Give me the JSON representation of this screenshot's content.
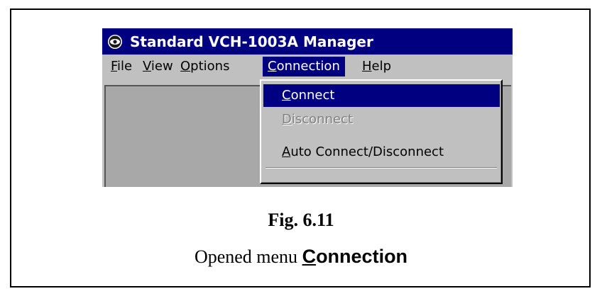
{
  "window": {
    "title": "Standard VCH-1003A Manager",
    "icon": "app-eye-icon"
  },
  "menubar": {
    "items": [
      {
        "label": "File",
        "mnemonic": "F",
        "rest": "ile"
      },
      {
        "label": "View",
        "mnemonic": "V",
        "rest": "iew"
      },
      {
        "label": "Options",
        "mnemonic": "O",
        "rest": "ptions"
      },
      {
        "label": "Connection",
        "mnemonic": "C",
        "rest": "onnection",
        "active": true
      },
      {
        "label": "Help",
        "mnemonic": "H",
        "rest": "elp"
      }
    ]
  },
  "dropdown": {
    "items": [
      {
        "label": "Connect",
        "mnemonic": "C",
        "rest": "onnect",
        "state": "highlighted"
      },
      {
        "label": "Disconnect",
        "mnemonic": "D",
        "rest": "isconnect",
        "state": "disabled"
      },
      {
        "label": "Auto Connect/Disconnect",
        "mnemonic": "A",
        "rest": "uto Connect/Disconnect",
        "state": "normal"
      }
    ]
  },
  "caption": {
    "figure": "Fig. 6.11",
    "text_prefix": "Opened menu",
    "menu_mnemonic": "C",
    "menu_rest": "onnection"
  },
  "colors": {
    "titlebar": "#000080",
    "menu_face": "#c0c0c0",
    "highlight": "#000080",
    "disabled_text": "#808080",
    "client_area": "#a8a8a8"
  }
}
